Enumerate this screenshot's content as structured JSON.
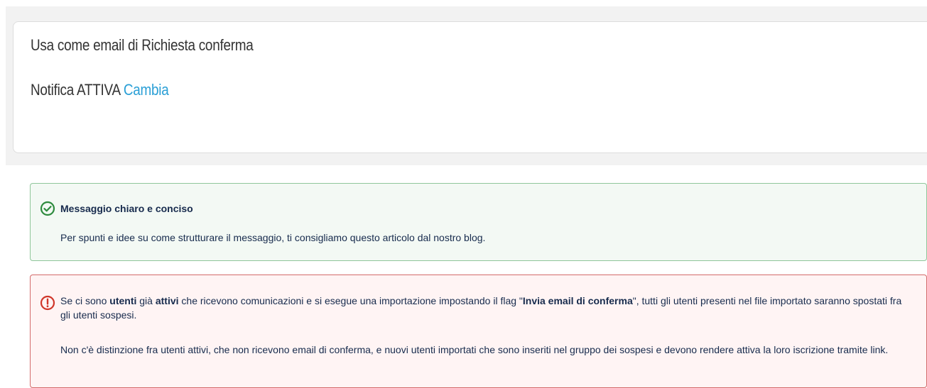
{
  "settings": {
    "title": "Usa come email di Richiesta conferma",
    "notify_prefix": "Notifica ATTIVA",
    "change_link": "Cambia",
    "link_color": "#2a9fd6"
  },
  "success_panel": {
    "icon": "check-circle-icon",
    "color": "#2e8b3e",
    "title": "Messaggio chiaro e conciso",
    "body": "Per spunti e idee su come strutturare il messaggio, ti consigliamo questo articolo dal nostro blog."
  },
  "error_panel": {
    "icon": "exclamation-circle-icon",
    "color": "#d0362a",
    "p1": {
      "t1": "Se ci sono ",
      "b1": "utenti",
      "t2": " già ",
      "b2": "attivi",
      "t3": " che ricevono comunicazioni e si esegue una importazione impostando il flag \"",
      "b3": "Invia email di conferma",
      "t4": "\", tutti gli utenti presenti nel file importato saranno spostati fra gli utenti sospesi."
    },
    "p2": "Non c'è distinzione fra utenti attivi, che non ricevono email di conferma, e nuovi utenti importati che sono inseriti nel gruppo dei sospesi e devono rendere attiva la loro iscrizione tramite link."
  }
}
